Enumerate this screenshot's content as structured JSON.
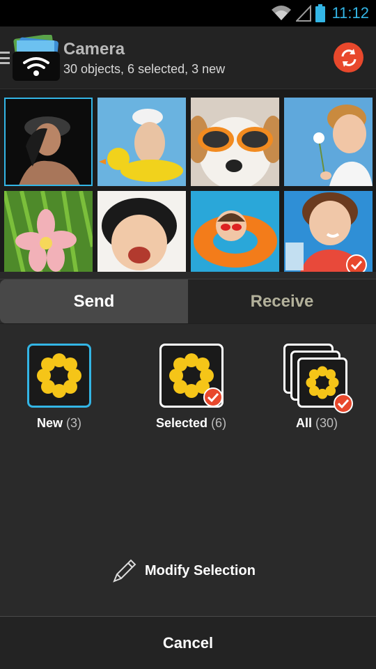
{
  "status_bar": {
    "time": "11:12",
    "icons": [
      "wifi-icon",
      "signal-icon",
      "battery-icon"
    ]
  },
  "header": {
    "title": "Camera",
    "subtitle": "30 objects, 6 selected, 3 new",
    "logo_icon": "wifi-photos-logo",
    "sync_icon": "sync-icon",
    "accent_color": "#e8482c"
  },
  "grid": {
    "selection_color": "#33b5e5",
    "photos": [
      {
        "name": "woman-in-hat",
        "selected": true,
        "checked": false
      },
      {
        "name": "child-with-duck-float",
        "selected": false,
        "checked": false
      },
      {
        "name": "dog-with-sunglasses",
        "selected": false,
        "checked": false
      },
      {
        "name": "child-with-dandelion",
        "selected": false,
        "checked": false
      },
      {
        "name": "pink-flower",
        "selected": false,
        "checked": false
      },
      {
        "name": "laughing-child",
        "selected": false,
        "checked": false
      },
      {
        "name": "child-in-swim-ring",
        "selected": false,
        "checked": false
      },
      {
        "name": "woman-with-drink",
        "selected": false,
        "checked": true
      }
    ]
  },
  "tabs": {
    "send": "Send",
    "receive": "Receive"
  },
  "options": [
    {
      "label": "New",
      "count": "(3)"
    },
    {
      "label": "Selected",
      "count": "(6)"
    },
    {
      "label": "All",
      "count": "(30)"
    }
  ],
  "modify_label": "Modify Selection",
  "cancel_label": "Cancel"
}
